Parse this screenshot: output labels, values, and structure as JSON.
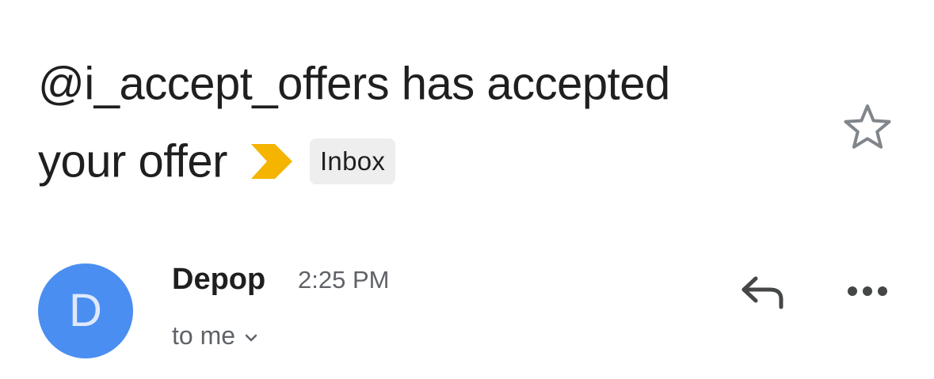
{
  "email": {
    "subject_line1": "@i_accept_offers has accepted",
    "subject_line2": "your offer",
    "label": "Inbox",
    "importance_icon": "importance-marker-icon",
    "star_icon": "star-outline-icon"
  },
  "sender": {
    "avatar_letter": "D",
    "name": "Depop",
    "time": "2:25 PM",
    "recipient": "to me",
    "expand_icon": "chevron-down-icon"
  },
  "actions": {
    "reply_icon": "reply-icon",
    "more_icon": "more-horizontal-icon"
  },
  "colors": {
    "avatar": "#4b8ef1",
    "importance": "#f4b400",
    "chip_bg": "#eeeeee",
    "text": "#1f1f1f",
    "secondary_text": "#5f6368"
  }
}
